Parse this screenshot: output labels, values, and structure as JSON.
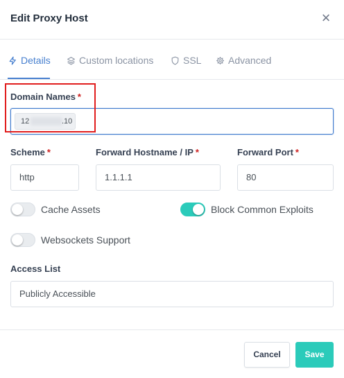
{
  "modal": {
    "title": "Edit Proxy Host",
    "close_glyph": "×"
  },
  "tabs": [
    {
      "label": "Details",
      "icon": "bolt-icon",
      "active": true
    },
    {
      "label": "Custom locations",
      "icon": "layers-icon",
      "active": false
    },
    {
      "label": "SSL",
      "icon": "shield-icon",
      "active": false
    },
    {
      "label": "Advanced",
      "icon": "gear-icon",
      "active": false
    }
  ],
  "domain": {
    "label": "Domain Names",
    "required_mark": "*",
    "chip_prefix": "12",
    "chip_suffix": ".10"
  },
  "scheme": {
    "label": "Scheme",
    "required_mark": "*",
    "value": "http"
  },
  "hostname": {
    "label": "Forward Hostname / IP",
    "required_mark": "*",
    "value": "1.1.1.1"
  },
  "port": {
    "label": "Forward Port",
    "required_mark": "*",
    "value": "80"
  },
  "toggles": {
    "cache_assets": {
      "label": "Cache Assets",
      "on": false
    },
    "block_exploits": {
      "label": "Block Common Exploits",
      "on": true
    },
    "websockets": {
      "label": "Websockets Support",
      "on": false
    }
  },
  "access_list": {
    "label": "Access List",
    "value": "Publicly Accessible"
  },
  "footer": {
    "cancel_label": "Cancel",
    "save_label": "Save"
  },
  "colors": {
    "accent": "#467fcf",
    "success": "#2bcbba",
    "required": "#cd201f",
    "highlight": "#e11d1d"
  }
}
